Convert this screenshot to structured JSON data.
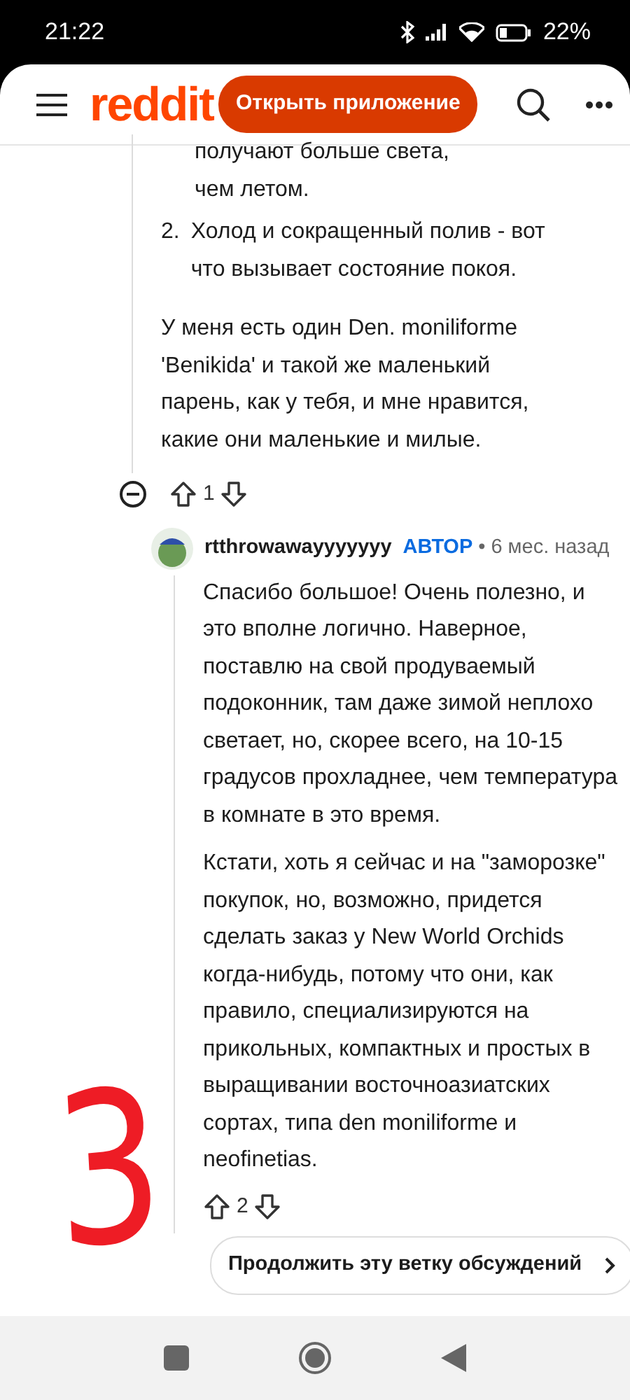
{
  "status_bar": {
    "time": "21:22",
    "battery": "22%"
  },
  "header": {
    "logo": "reddit",
    "open_app_button": "Открыть приложение"
  },
  "parent_comment": {
    "list_tail": "получают больше света, чем летом.",
    "list_items": [
      {
        "number": "2.",
        "text": "Холод и сокращенный полив - вот что вызывает состояние покоя."
      }
    ],
    "paragraphs": [
      "У меня есть один Den. moniliforme 'Benikida' и такой же маленький парень, как у тебя, и мне нравится, какие они маленькие и милые."
    ],
    "score": "1"
  },
  "reply": {
    "author": "rtthrowawayyyyyyy",
    "author_badge": "АВТОР",
    "separator": "•",
    "time": "6 мес. назад",
    "paragraphs": [
      "Спасибо большое! Очень полезно, и это вполне логично. Наверное, поставлю на свой продуваемый подоконник, там даже зимой неплохо светает, но, скорее всего, на 10-15 градусов прохладнее, чем температура в комнате в это время.",
      "Кстати, хоть я сейчас и на \"заморозке\" покупок, но, возможно, придется сделать заказ у New World Orchids когда-нибудь, потому что они, как правило, специализируются на прикольных, компактных и простых в выращивании восточноазиатских сортах, типа den moniliforme и neofinetias."
    ],
    "score": "2"
  },
  "continue_button": "Продолжить эту ветку обсуждений",
  "annotation": "3"
}
